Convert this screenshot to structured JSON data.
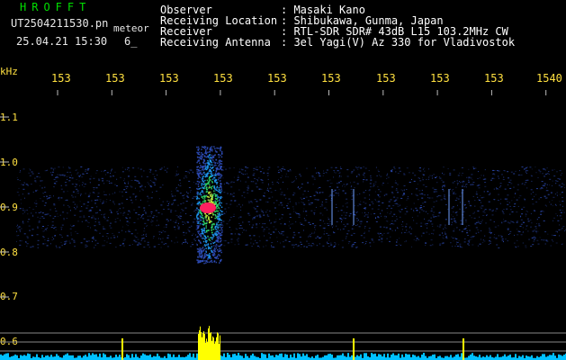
{
  "header": {
    "brand": "HROFFT",
    "filename": "UT2504211530.pn",
    "file_type": "meteor",
    "date_time": "25.04.21 15:30",
    "count": "6_",
    "rows": [
      {
        "label": "Observer",
        "value": ": Masaki Kano"
      },
      {
        "label": "Receiving Location",
        "value": ": Shibukawa, Gunma, Japan"
      },
      {
        "label": "Receiver",
        "value": ": RTL-SDR SDR# 43dB L15 103.2MHz CW"
      },
      {
        "label": "Receiving Antenna",
        "value": ": 3el Yagi(V) Az 330 for Vladivostok"
      }
    ]
  },
  "axes": {
    "y_unit": "kHz",
    "y_ticks": [
      "1.1",
      "1.0",
      "0.9",
      "0.8",
      "0.7",
      "0.6"
    ],
    "x_ticks": [
      "153",
      "153",
      "153",
      "153",
      "153",
      "153",
      "153",
      "153",
      "153",
      "1540"
    ]
  },
  "colors": {
    "background": "#000000",
    "axis_text": "#ffe040",
    "brand": "#00e000",
    "signal_core": "#ff2060",
    "signal_mid": "#30e070",
    "noise": "#3050c0",
    "level_bars": "#ffff00",
    "baseline": "#00c0ff"
  }
}
